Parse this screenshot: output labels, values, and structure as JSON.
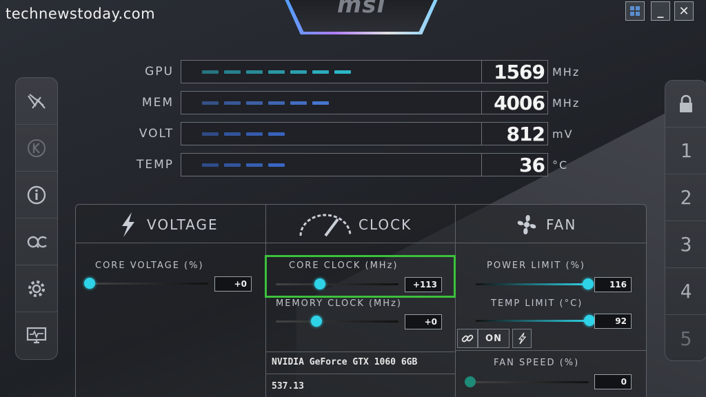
{
  "watermark": "technewstoday.com",
  "app": {
    "logo_text": "msi"
  },
  "window_controls": {
    "minimize": "_",
    "close": "✕"
  },
  "left_sidebar": [
    {
      "icon": "msi-dragon-icon"
    },
    {
      "icon": "kombustor-k-icon"
    },
    {
      "icon": "info-icon"
    },
    {
      "icon": "oc-scanner-icon"
    },
    {
      "icon": "settings-gear-icon"
    },
    {
      "icon": "monitor-icon"
    }
  ],
  "right_sidebar": {
    "lock_icon": "lock-icon",
    "profiles": [
      "1",
      "2",
      "3",
      "4",
      "5"
    ]
  },
  "monitor": [
    {
      "label": "GPU",
      "value": "1569",
      "unit": "MHz",
      "level": 0.62,
      "color": "#2fc6d8"
    },
    {
      "label": "MEM",
      "value": "4006",
      "unit": "MHz",
      "level": 0.52,
      "color": "#4a7de0"
    },
    {
      "label": "VOLT",
      "value": "812",
      "unit": "mV",
      "level": 0.4,
      "color": "#3d6fd8"
    },
    {
      "label": "TEMP",
      "value": "36",
      "unit": "°C",
      "level": 0.36,
      "color": "#3d6fd8"
    }
  ],
  "sections": {
    "voltage": {
      "title": "VOLTAGE",
      "icon": "lightning-icon"
    },
    "clock": {
      "title": "CLOCK",
      "icon": "speedometer-icon"
    },
    "fan": {
      "title": "FAN",
      "icon": "fan-icon"
    }
  },
  "sliders": {
    "core_voltage": {
      "label": "CORE VOLTAGE  (%)",
      "value": "+0",
      "level": 0.0
    },
    "core_clock": {
      "label": "CORE CLOCK (MHz)",
      "value": "+113",
      "level": 0.36
    },
    "memory_clock": {
      "label": "MEMORY CLOCK (MHz)",
      "value": "+0",
      "level": 0.33
    },
    "power_limit": {
      "label": "POWER LIMIT (%)",
      "value": "116",
      "level": 1.0
    },
    "temp_limit": {
      "label": "TEMP LIMIT (°C)",
      "value": "92",
      "level": 1.0
    },
    "fan_speed": {
      "label": "FAN SPEED (%)",
      "value": "0",
      "level": 0.0
    }
  },
  "link_toggle": {
    "on_label": "ON"
  },
  "gpu": {
    "name": "NVIDIA GeForce GTX 1060 6GB",
    "driver": "537.13"
  }
}
